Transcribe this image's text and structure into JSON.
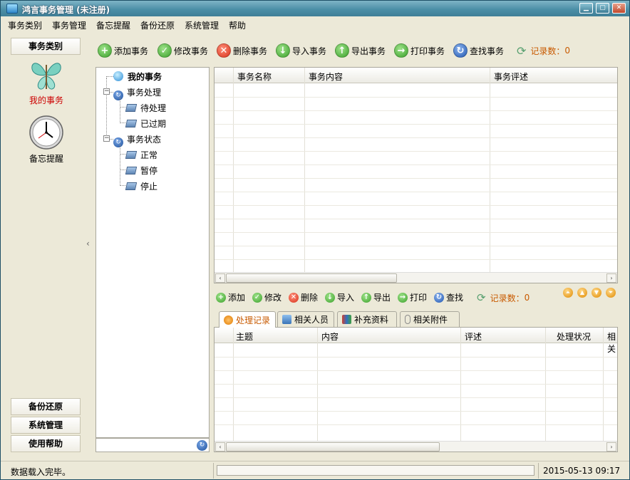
{
  "window": {
    "title": "鸿言事务管理 (未注册)"
  },
  "menu": [
    "事务类别",
    "事务管理",
    "备忘提醒",
    "备份还原",
    "系统管理",
    "帮助"
  ],
  "sidebar": {
    "top_button": "事务类别",
    "items": [
      {
        "label": "我的事务",
        "icon": "butterfly-icon",
        "color": "#cc0000"
      },
      {
        "label": "备忘提醒",
        "icon": "clock-icon",
        "color": "#000000"
      }
    ],
    "bottom_buttons": [
      "备份还原",
      "系统管理",
      "使用帮助"
    ]
  },
  "toolbar": {
    "add": "添加事务",
    "edit": "修改事务",
    "delete": "删除事务",
    "import": "导入事务",
    "export": "导出事务",
    "print": "打印事务",
    "find": "查找事务",
    "record_label": "记录数：",
    "record_count": "0"
  },
  "tree": {
    "root": "我的事务",
    "groups": [
      {
        "label": "事务处理",
        "children": [
          "待处理",
          "已过期"
        ]
      },
      {
        "label": "事务状态",
        "children": [
          "正常",
          "暂停",
          "停止"
        ]
      }
    ]
  },
  "main_grid": {
    "columns": [
      "事务名称",
      "事务内容",
      "事务评述"
    ]
  },
  "sub_toolbar": {
    "add": "添加",
    "edit": "修改",
    "delete": "删除",
    "import": "导入",
    "export": "导出",
    "print": "打印",
    "find": "查找",
    "record_label": "记录数：",
    "record_count": "0"
  },
  "tabs": [
    "处理记录",
    "相关人员",
    "补充资料",
    "相关附件"
  ],
  "detail_grid": {
    "columns": [
      "主题",
      "内容",
      "评述",
      "处理状况",
      "相关"
    ]
  },
  "status": {
    "message": "数据载入完毕。",
    "datetime": "2015-05-13 09:17"
  },
  "colors": {
    "accent_orange": "#c85a00",
    "selected_red": "#cc0000"
  }
}
